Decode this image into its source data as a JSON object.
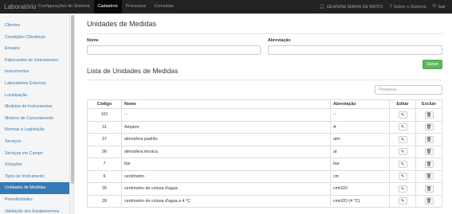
{
  "topbar": {
    "brand": "Laboratório",
    "nav": [
      "Configurações do Sistema",
      "Cadastros",
      "Processos",
      "Consultas"
    ],
    "active_nav": "Cadastros",
    "user": "GEANINE MARIA DE BRITO",
    "about": "Sobre o Sistema",
    "logout": "Sair"
  },
  "sidebar": {
    "items": [
      "Clientes",
      "Condições Climáticas",
      "Ensaios",
      "Fabricantes de Instrumentos",
      "Instrumentos",
      "Laboratórios Externos",
      "Localização",
      "Modelos de Instrumentos",
      "Motivos de Cancelamento",
      "Normas e Legislação",
      "Serviços",
      "Serviços em Campo",
      "Soluções",
      "Tipos de Instrumento",
      "Unidades de Medidas",
      "Periodicidades",
      "Validação dos Equipamentos"
    ],
    "active": "Unidades de Medidas"
  },
  "main": {
    "title": "Unidades de Medidas",
    "form": {
      "name_label": "Nome",
      "name_value": "",
      "abrev_label": "Abreviação",
      "abrev_value": "",
      "save_label": "Salvar"
    },
    "list_title": "Lista de Unidades de Medidas",
    "search_placeholder": "Pesquisar...",
    "table": {
      "headers": [
        "Código",
        "Nome",
        "Abreviação",
        "Editar",
        "Excluir"
      ],
      "rows": [
        [
          "101",
          "--",
          "--"
        ],
        [
          "31",
          "Ampere",
          "A"
        ],
        [
          "37",
          "atmosfera padrão",
          "atm"
        ],
        [
          "36",
          "atmosfera técnica",
          "at"
        ],
        [
          "7",
          "bar",
          "bar"
        ],
        [
          "6",
          "centímetro",
          "cm"
        ],
        [
          "35",
          "centímetro de coluna d'agua",
          "cmH2O"
        ],
        [
          "39",
          "centímetro de coluna d'agua a 4 °C",
          "cmH2O (4 °C)"
        ]
      ]
    }
  },
  "colors": {
    "accent": "#337ab7",
    "save": "#5cb85c",
    "topbar": "#222222"
  },
  "icons": {
    "user": "user-icon",
    "about": "question-circle-icon",
    "logout": "power-icon",
    "edit": "pencil-icon",
    "delete": "trash-icon"
  }
}
